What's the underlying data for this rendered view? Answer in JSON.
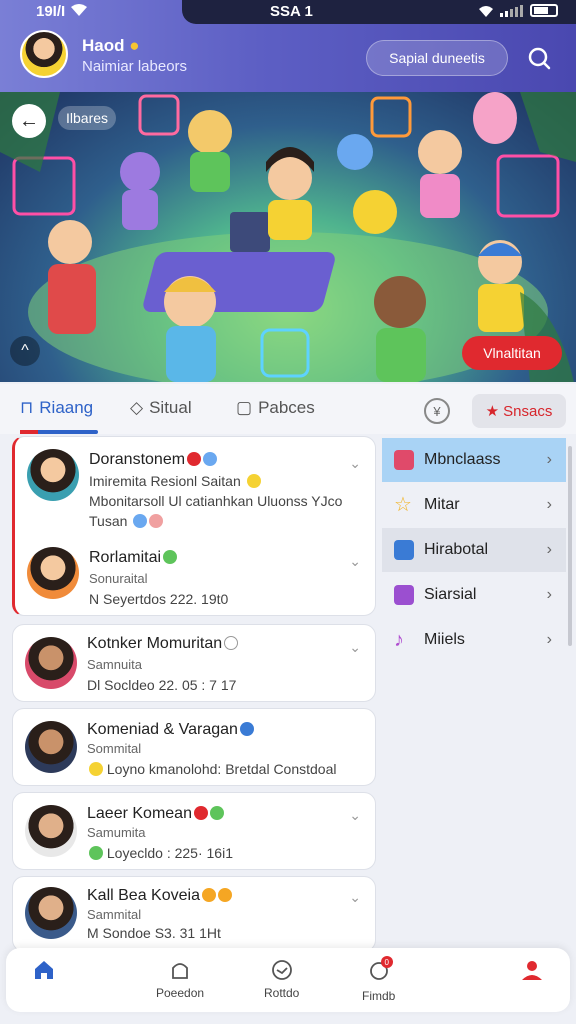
{
  "status_bar": {
    "time": "19I/I",
    "center": "SSA 1"
  },
  "header": {
    "user_name": "Haod",
    "user_subtitle": "Naimiar labeors",
    "search_label": "Sapial duneetis"
  },
  "hero": {
    "chip_label": "Ilbares",
    "cta_label": "Vlnaltitan"
  },
  "tabs": [
    {
      "label": "Riaang",
      "active": true
    },
    {
      "label": "Situal",
      "active": false
    },
    {
      "label": "Pabces",
      "active": false
    }
  ],
  "tab_action": {
    "label": "Snsacs"
  },
  "feed": [
    {
      "title": "Doranstonem",
      "line1": "Imiremita Resionl Saitan",
      "line2": "Mbonitarsoll Ul catianhkan Uluonss YJco",
      "line3": "Tusan"
    },
    {
      "title": "Rorlamitai",
      "sub": "Sonuraital",
      "meta": "N Seyertdos 222. 19t0"
    },
    {
      "title": "Kotnker Momuritan",
      "sub": "Samnuita",
      "meta": "Dl Socldeo 22. 05 : 7 17"
    },
    {
      "title": "Komeniad & Varagan",
      "sub": "Sommital",
      "meta": "Loyno kmanolohd: Bretdal Constdoal"
    },
    {
      "title": "Laeer Komean",
      "sub": "Samumita",
      "meta": "Loyecldo : 225· 16i1"
    },
    {
      "title": "Kall Bea Koveia",
      "sub": "Sammital",
      "meta": "M Sondoe S3. 31 1Ht"
    }
  ],
  "categories": [
    {
      "label": "Mbnclaass",
      "icon": "cube-icon",
      "color": "#e04a6a"
    },
    {
      "label": "Mitar",
      "icon": "star-icon",
      "color": "#f2b321"
    },
    {
      "label": "Hirabotal",
      "icon": "box-icon",
      "color": "#3a7bd5"
    },
    {
      "label": "Siarsial",
      "icon": "gift-icon",
      "color": "#9b4fd0"
    },
    {
      "label": "Miiels",
      "icon": "music-icon",
      "color": "#b04fd0"
    }
  ],
  "bottom_nav": [
    {
      "label": ""
    },
    {
      "label": "Poeedon"
    },
    {
      "label": "Rottdo"
    },
    {
      "label": "Fimdb"
    },
    {
      "label": ""
    }
  ],
  "colors": {
    "accent": "#2e62c8",
    "danger": "#e0292f",
    "header": "#5d5fc4"
  }
}
